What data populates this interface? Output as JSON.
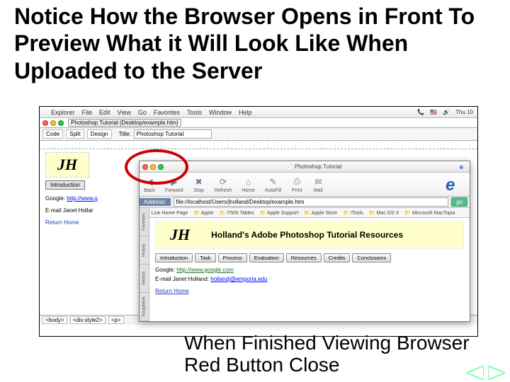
{
  "slide": {
    "title": "Notice How the Browser Opens in Front To Preview What it Will Look Like When Uploaded to the Server",
    "bottom_text": "When Finished Viewing Browser Red Button Close"
  },
  "menubar": {
    "apple": "",
    "items": [
      "Explorer",
      "File",
      "Edit",
      "View",
      "Go",
      "Favorites",
      "Tools",
      "Window",
      "Help"
    ],
    "right": {
      "phone": "📞",
      "flag": "🇺🇸",
      "vol": "🔊",
      "clock": "Thu 10"
    }
  },
  "dw": {
    "doc_label": "Photoshop Tutorial (Desktop/example.htm)",
    "view": {
      "code": "Code",
      "split": "Split",
      "design": "Design"
    },
    "title_label": "Title:",
    "title_value": "Photoshop Tutorial",
    "bg": {
      "logo": "JH",
      "intro_tab": "Introduction",
      "google_label": "Google:",
      "google_link": "http://www.g",
      "email_label": "E-mail Janet Hollar",
      "return": "Return Home"
    },
    "status": {
      "tags": [
        "<body>",
        "<div.style2>",
        "<p>"
      ]
    }
  },
  "browser": {
    "title": "Photoshop Tutorial",
    "toolbar": [
      {
        "icon": "◀",
        "label": "Back"
      },
      {
        "icon": "▶",
        "label": "Forward"
      },
      {
        "icon": "✖",
        "label": "Stop"
      },
      {
        "icon": "⟳",
        "label": "Refresh"
      },
      {
        "icon": "⌂",
        "label": "Home"
      },
      {
        "icon": "✎",
        "label": "AutoFill"
      },
      {
        "icon": "⎙",
        "label": "Print"
      },
      {
        "icon": "✉",
        "label": "Mail"
      }
    ],
    "address_label": "Address:",
    "address_value": "file://localhost/Users/jholland/Desktop/example.htm",
    "go": "go",
    "favorites": [
      "Live Home Page",
      "Apple",
      "iTMS Tables",
      "Apple Support",
      "Apple Store",
      "iTools",
      "Mac OS X",
      "Microsoft MacTopia"
    ],
    "side_tabs": [
      "Favorites",
      "History",
      "Search",
      "Scrapbook"
    ],
    "page": {
      "logo": "JH",
      "hero_title": "Holland's Adobe Photoshop Tutorial Resources",
      "tabs": [
        "Introduction",
        "Task",
        "Process",
        "Evaluation",
        "Resources",
        "Credits",
        "Conclusions"
      ],
      "google_label": "Google:",
      "google_link": "http://www.google.com",
      "email_label": "E-mail Janet Holland:",
      "email_link": "hollandj@emporia.edu",
      "return": "Return Home"
    }
  }
}
